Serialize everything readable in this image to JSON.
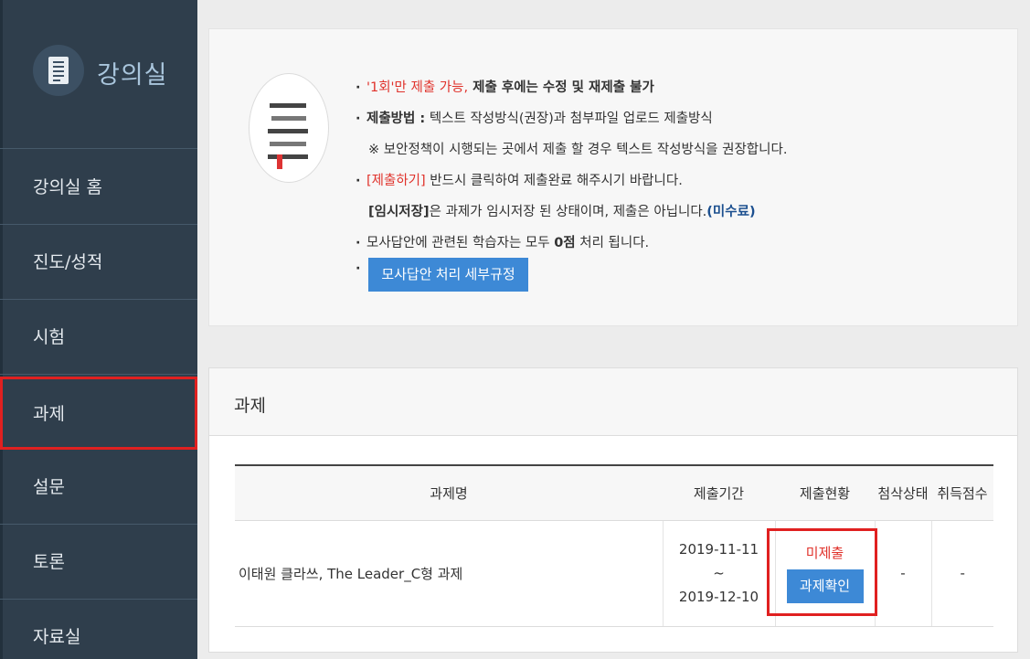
{
  "sidebar": {
    "title": "강의실",
    "items": [
      {
        "label": "강의실 홈"
      },
      {
        "label": "진도/성적"
      },
      {
        "label": "시험"
      },
      {
        "label": "과제"
      },
      {
        "label": "설문"
      },
      {
        "label": "토론"
      },
      {
        "label": "자료실"
      }
    ],
    "active_index": 3
  },
  "notice": {
    "line1_red": "'1회'만 제출 가능,",
    "line1_rest": " 제출 후에는 수정 및 재제출 불가",
    "line2_bold": "제출방법 :",
    "line2_rest": " 텍스트 작성방식(권장)과 첨부파일 업로드 제출방식",
    "line3": "※ 보안정책이 시행되는 곳에서 제출 할 경우 텍스트 작성방식을 권장합니다.",
    "line4_red": "[제출하기]",
    "line4_rest": " 반드시 클릭하여 제출완료 해주시기 바랍니다.",
    "line5_bold": "[임시저장]",
    "line5_rest": "은 과제가 임시저장 된 상태이며, 제출은 아닙니다.",
    "line5_blue": "(미수료)",
    "line6_pre": "모사답안에 관련된 학습자는 모두 ",
    "line6_bold": "0점",
    "line6_post": " 처리 됩니다.",
    "rule_button": "모사답안 처리 세부규정"
  },
  "panel": {
    "title": "과제",
    "columns": [
      "과제명",
      "제출기간",
      "제출현황",
      "첨삭상태",
      "취득점수"
    ],
    "rows": [
      {
        "name": "이태원 클라쓰, The Leader_C형 과제",
        "start": "2019-11-11",
        "sep": "~",
        "end": "2019-12-10",
        "status": "미제출",
        "button": "과제확인",
        "review": "-",
        "score": "-"
      }
    ]
  },
  "colors": {
    "sidebar_bg": "#2f3e4c",
    "accent_blue": "#3d89d6",
    "highlight_red": "#e02020",
    "status_red": "#e0322b"
  }
}
